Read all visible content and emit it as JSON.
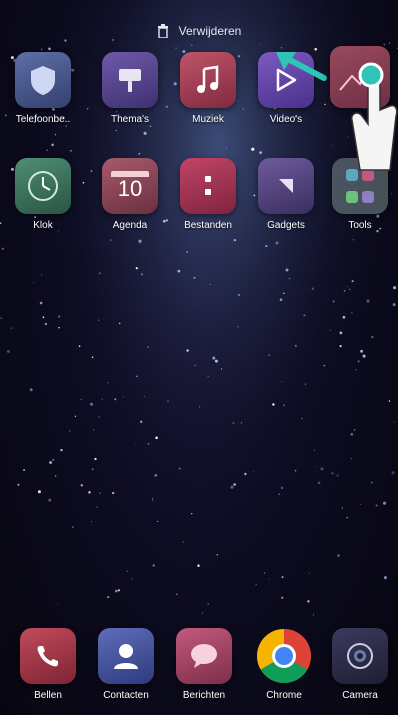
{
  "delete_bar": {
    "label": "Verwijderen",
    "icon": "trash-icon"
  },
  "home_rows": [
    [
      {
        "label": "Telefoonbe..",
        "icon": "shield-icon",
        "color": "#4a5a8e"
      },
      {
        "label": "Thema's",
        "icon": "brush-icon",
        "color": "#5a4a8e"
      },
      {
        "label": "Muziek",
        "icon": "music-note-icon",
        "color": "#a8445a"
      },
      {
        "label": "Video's",
        "icon": "play-icon",
        "color": "#6a4aa8"
      }
    ],
    [
      {
        "label": "Klok",
        "icon": "clock-icon",
        "color": "#3a6a58"
      },
      {
        "label": "Agenda",
        "icon": "calendar-icon",
        "color": "#8e4a5a",
        "day": "10"
      },
      {
        "label": "Bestanden",
        "icon": "folder-icon",
        "color": "#a83a5a"
      },
      {
        "label": "Gadgets",
        "icon": "widget-icon",
        "color": "#5a4a7a"
      },
      {
        "label": "Tools",
        "icon": "tools-folder-icon",
        "color": "#4a6a6a"
      }
    ]
  ],
  "dock": [
    {
      "label": "Bellen",
      "icon": "phone-icon",
      "color": "#a83a4a"
    },
    {
      "label": "Contacten",
      "icon": "contact-icon",
      "color": "#4a5a9e"
    },
    {
      "label": "Berichten",
      "icon": "message-icon",
      "color": "#a84a6a"
    },
    {
      "label": "Chrome",
      "icon": "chrome-icon",
      "color": "#ffffff"
    },
    {
      "label": "Camera",
      "icon": "camera-icon",
      "color": "#2a2a4a"
    }
  ],
  "gesture": {
    "icon": "hand-pointer-icon",
    "arrow": "drag-arrow-icon"
  }
}
